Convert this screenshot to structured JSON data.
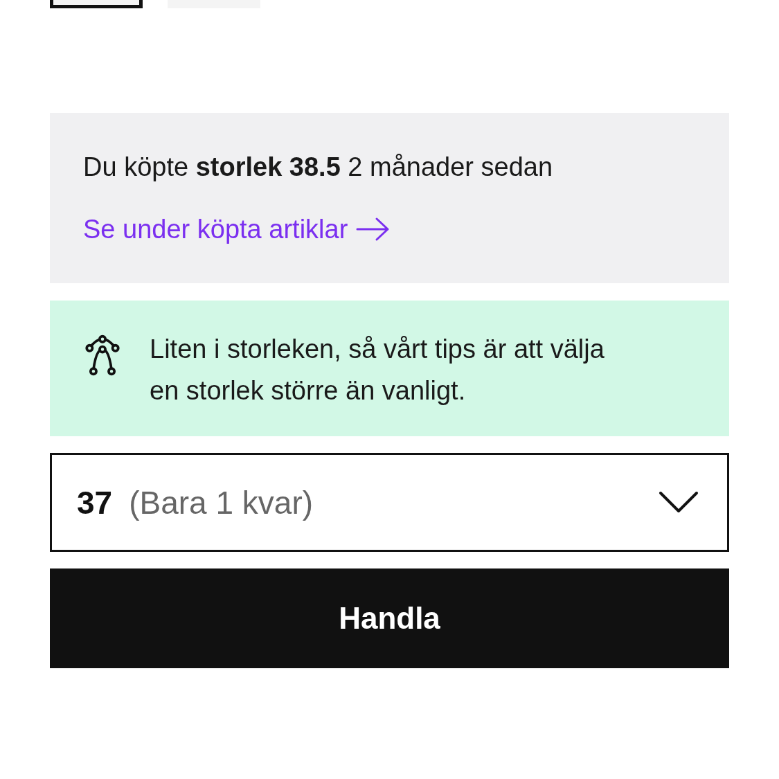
{
  "size_tiles": [
    {
      "selected": true
    },
    {
      "selected": false
    }
  ],
  "purchase_notice": {
    "text": "Du köpte **storlek 38.5** 2 månader sedan",
    "link": "Se under köpta artiklar"
  },
  "fit_tip": {
    "text": "Liten i storleken, så vårt tips är att välja en storlek större än vanligt."
  },
  "size_select": {
    "value": "37",
    "note": "(Bara 1 kvar)"
  },
  "buy_button": {
    "label": "Handla"
  }
}
